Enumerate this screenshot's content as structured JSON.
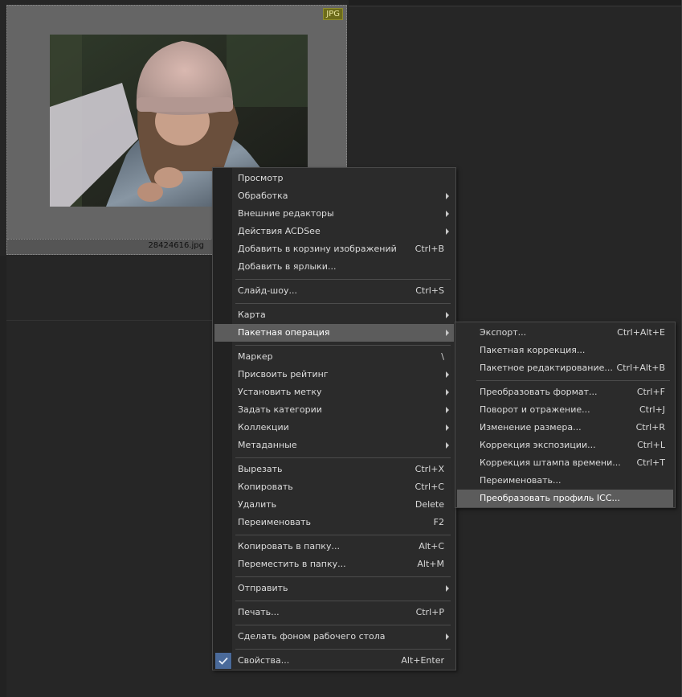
{
  "thumbnail": {
    "badge": "JPG",
    "filename": "28424616.jpg"
  },
  "context_menu": {
    "items": [
      {
        "label": "Просмотр",
        "shortcut": ""
      },
      {
        "label": "Обработка",
        "shortcut": ""
      },
      {
        "label": "Внешние редакторы",
        "shortcut": ""
      },
      {
        "label": "Действия ACDSee",
        "shortcut": ""
      },
      {
        "label": "Добавить в корзину изображений",
        "shortcut": "Ctrl+B"
      },
      {
        "label": "Добавить в ярлыки...",
        "shortcut": ""
      },
      {
        "label": "Слайд-шоу...",
        "shortcut": "Ctrl+S"
      },
      {
        "label": "Карта",
        "shortcut": ""
      },
      {
        "label": "Пакетная операция",
        "shortcut": ""
      },
      {
        "label": "Маркер",
        "shortcut": "\\"
      },
      {
        "label": "Присвоить рейтинг",
        "shortcut": ""
      },
      {
        "label": "Установить метку",
        "shortcut": ""
      },
      {
        "label": "Задать категории",
        "shortcut": ""
      },
      {
        "label": "Коллекции",
        "shortcut": ""
      },
      {
        "label": "Метаданные",
        "shortcut": ""
      },
      {
        "label": "Вырезать",
        "shortcut": "Ctrl+X"
      },
      {
        "label": "Копировать",
        "shortcut": "Ctrl+C"
      },
      {
        "label": "Удалить",
        "shortcut": "Delete"
      },
      {
        "label": "Переименовать",
        "shortcut": "F2"
      },
      {
        "label": "Копировать в папку...",
        "shortcut": "Alt+C"
      },
      {
        "label": "Переместить в папку...",
        "shortcut": "Alt+M"
      },
      {
        "label": "Отправить",
        "shortcut": ""
      },
      {
        "label": "Печать...",
        "shortcut": "Ctrl+P"
      },
      {
        "label": "Сделать фоном рабочего стола",
        "shortcut": ""
      },
      {
        "label": "Свойства...",
        "shortcut": "Alt+Enter"
      }
    ]
  },
  "submenu": {
    "items": [
      {
        "label": "Экспорт...",
        "shortcut": "Ctrl+Alt+E"
      },
      {
        "label": "Пакетная коррекция...",
        "shortcut": ""
      },
      {
        "label": "Пакетное редактирование...",
        "shortcut": "Ctrl+Alt+B"
      },
      {
        "label": "Преобразовать формат...",
        "shortcut": "Ctrl+F"
      },
      {
        "label": "Поворот и отражение...",
        "shortcut": "Ctrl+J"
      },
      {
        "label": "Изменение размера...",
        "shortcut": "Ctrl+R"
      },
      {
        "label": "Коррекция экспозиции...",
        "shortcut": "Ctrl+L"
      },
      {
        "label": "Коррекция штампа времени...",
        "shortcut": "Ctrl+T"
      },
      {
        "label": "Переименовать...",
        "shortcut": ""
      },
      {
        "label": "Преобразовать профиль ICC...",
        "shortcut": ""
      }
    ]
  },
  "colors": {
    "background": "#262626",
    "menu_bg": "#2b2b2b",
    "highlight": "#5c5c5c",
    "check_accent": "#4a6a9a",
    "badge": "#6c6b1a"
  }
}
